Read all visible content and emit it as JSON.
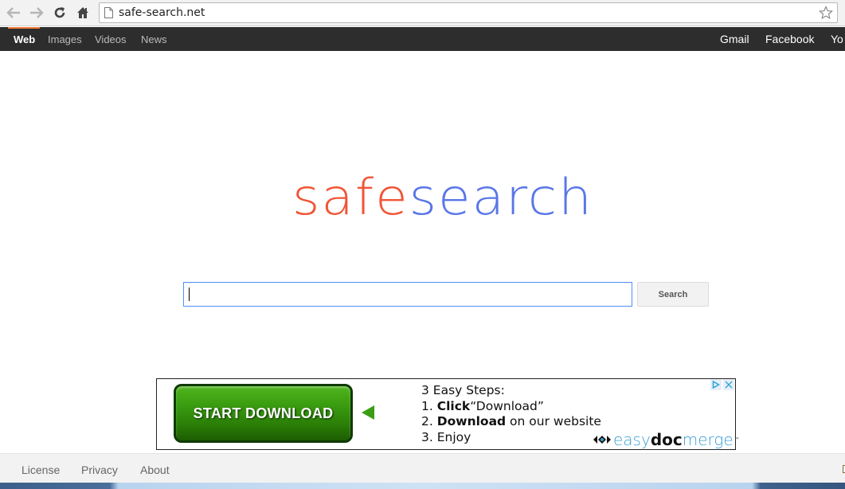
{
  "browser": {
    "url": "safe-search.net",
    "icons": [
      "back-arrow-icon",
      "forward-arrow-icon",
      "reload-icon",
      "home-icon",
      "page-icon",
      "bookmark-star-icon"
    ]
  },
  "topnav": {
    "left": [
      {
        "label": "Web",
        "active": true
      },
      {
        "label": "Images",
        "active": false
      },
      {
        "label": "Videos",
        "active": false
      },
      {
        "label": "News",
        "active": false
      }
    ],
    "right": [
      {
        "label": "Gmail"
      },
      {
        "label": "Facebook"
      },
      {
        "label": "Yo"
      }
    ],
    "accent_color": "#f07c3a"
  },
  "logo": {
    "part1": "safe",
    "part2": "search",
    "part1_color": "#f05535",
    "part2_color": "#5a76e8"
  },
  "search": {
    "value": "",
    "button_label": "Search"
  },
  "ad": {
    "button_label": "START DOWNLOAD",
    "steps_title": "3 Easy Steps:",
    "step1_num": "1.",
    "step1_bold": "Click",
    "step1_rest": "“Download”",
    "step2_num": "2.",
    "step2_bold": "Download",
    "step2_rest": " on our website",
    "step3": "3. Enjoy",
    "brand_light": "easy",
    "brand_bold": "doc",
    "brand_light2": "merge",
    "brand_tm": "™",
    "adchoices_icon": "adchoices-icon",
    "close_icon": "close-icon"
  },
  "footer": {
    "links": [
      "License",
      "Privacy",
      "About"
    ]
  }
}
